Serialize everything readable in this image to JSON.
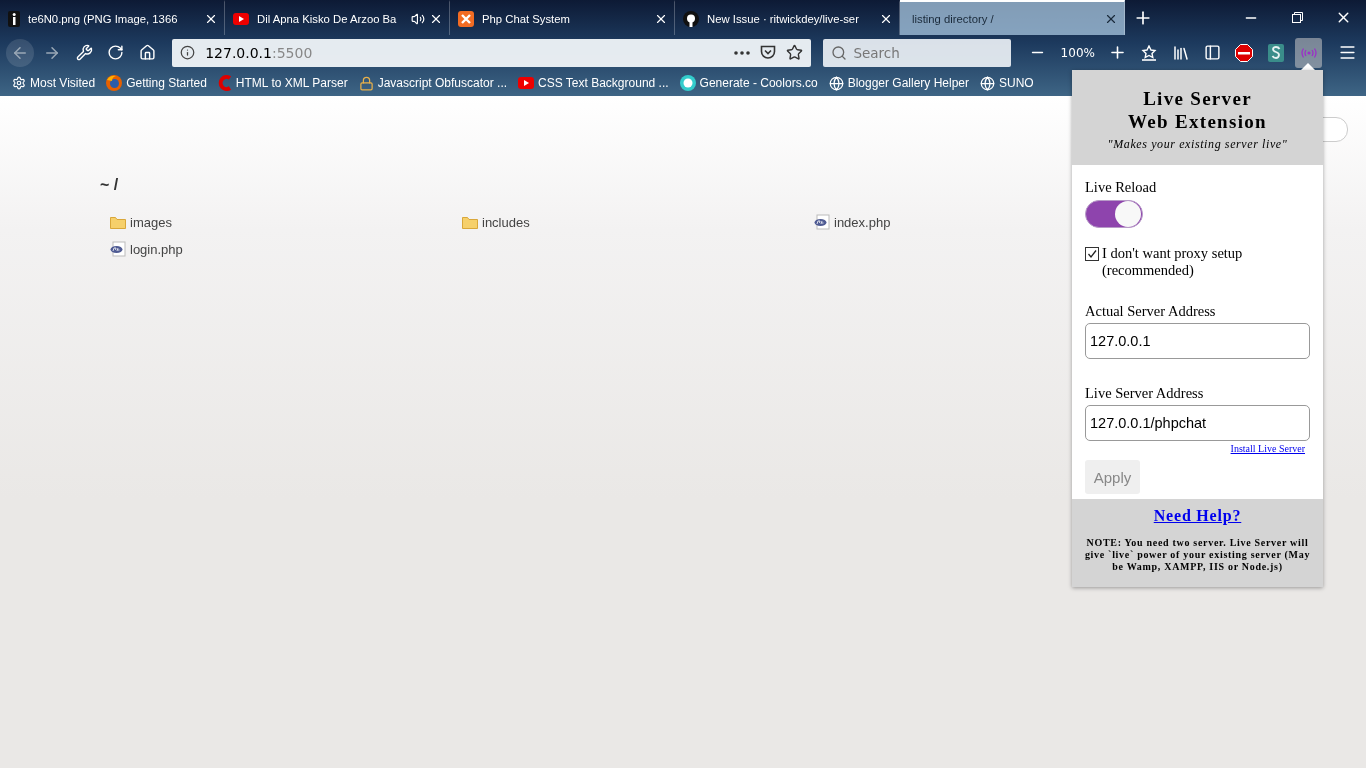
{
  "tabs": [
    {
      "title": "te6N0.png (PNG Image, 1366",
      "selected": false,
      "playing": false
    },
    {
      "title": "Dil Apna Kisko De Arzoo Ba",
      "selected": false,
      "playing": true
    },
    {
      "title": "Php Chat System",
      "selected": false,
      "playing": false
    },
    {
      "title": "New Issue · ritwickdey/live-ser",
      "selected": false,
      "playing": false
    },
    {
      "title": "listing directory /",
      "selected": true,
      "playing": false
    }
  ],
  "toolbar": {
    "url_host": "127.0.0.1",
    "url_port": ":5500",
    "search_placeholder": "Search",
    "zoom": "100%"
  },
  "bookmarks": [
    {
      "label": "Most Visited"
    },
    {
      "label": "Getting Started"
    },
    {
      "label": "HTML to XML Parser"
    },
    {
      "label": "Javascript Obfuscator ..."
    },
    {
      "label": "CSS Text Background ..."
    },
    {
      "label": "Generate - Coolors.co"
    },
    {
      "label": "Blogger Gallery Helper"
    },
    {
      "label": "SUNO"
    }
  ],
  "listing": {
    "heading": "~ /",
    "items": [
      {
        "name": "images",
        "kind": "folder"
      },
      {
        "name": "includes",
        "kind": "folder"
      },
      {
        "name": "index.php",
        "kind": "php"
      },
      {
        "name": "login.php",
        "kind": "php"
      }
    ]
  },
  "popup": {
    "title_lines": [
      "Live Server",
      "Web Extension"
    ],
    "tagline": "\"Makes your existing server live\"",
    "live_reload": {
      "label": "Live Reload",
      "on": true
    },
    "proxy": {
      "label": "I don't want proxy setup (recommended)",
      "checked": true
    },
    "fields": [
      {
        "label": "Actual Server Address",
        "value": "127.0.0.1"
      },
      {
        "label": "Live Server Address",
        "value": "127.0.0.1/phpchat"
      }
    ],
    "install_link": "Install Live Server",
    "apply": {
      "label": "Apply",
      "disabled": true
    },
    "help_link": "Need Help?",
    "note": "NOTE: You need two server. Live Server will give `live` power of your existing server (May be Wamp, XAMPP, IIS or Node.js)"
  }
}
